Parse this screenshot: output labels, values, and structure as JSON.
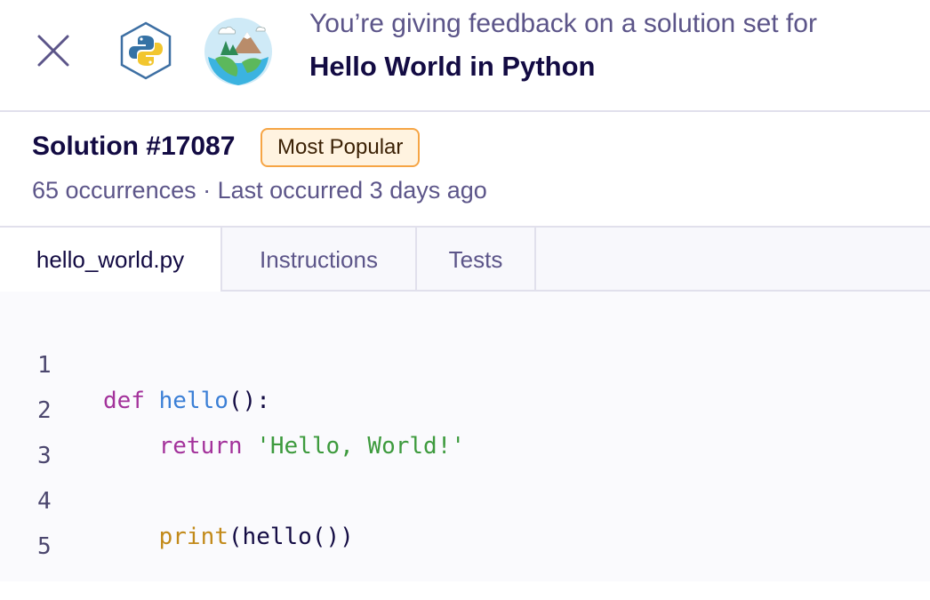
{
  "header": {
    "close_icon": "close-x-icon",
    "track_icon": "python-logo-icon",
    "exercise_icon": "hello-world-globe-icon",
    "subtitle": "You’re giving feedback on a solution set for",
    "title": "Hello World in Python"
  },
  "solution": {
    "title": "Solution #17087",
    "badge": "Most Popular",
    "meta": "65 occurrences · Last occurred 3 days ago"
  },
  "tabs": [
    {
      "label": "hello_world.py",
      "active": true
    },
    {
      "label": "Instructions",
      "active": false
    },
    {
      "label": "Tests",
      "active": false
    }
  ],
  "code": {
    "line_numbers": [
      "1",
      "2",
      "3",
      "4",
      "5"
    ],
    "tokens": {
      "l1_def": "def",
      "l1_name": "hello",
      "l1_rest": "():",
      "l2_return": "return",
      "l2_string": "'Hello, World!'",
      "l4_print": "print",
      "l4_rest": "(hello())"
    }
  },
  "colors": {
    "keyword": "#a3329b",
    "function": "#3b7fd6",
    "string": "#3d9a3d",
    "builtin": "#c28a1a",
    "badge_border": "#f6a545",
    "badge_bg": "#fff3e0"
  }
}
